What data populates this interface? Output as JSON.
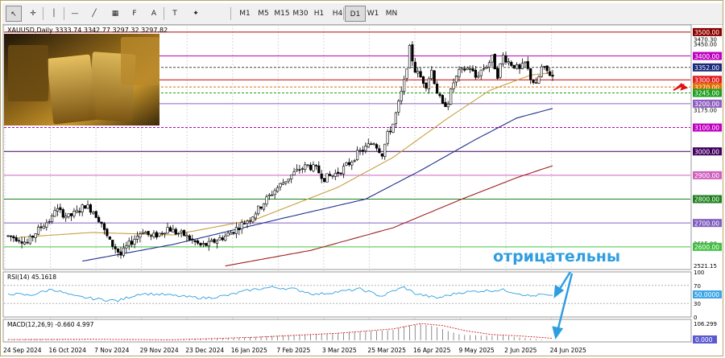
{
  "toolbar": {
    "tools": [
      {
        "name": "cursor-tool",
        "glyph": "↖",
        "active": true
      },
      {
        "name": "crosshair-tool",
        "glyph": "✛",
        "active": false
      },
      {
        "name": "vertical-line-tool",
        "glyph": "│",
        "active": false
      },
      {
        "name": "horizontal-line-tool",
        "glyph": "—",
        "active": false
      },
      {
        "name": "trendline-tool",
        "glyph": "╱",
        "active": false
      },
      {
        "name": "channel-tool",
        "glyph": "▦",
        "active": false
      },
      {
        "name": "fibonacci-tool",
        "glyph": "F",
        "active": false
      },
      {
        "name": "text-tool",
        "glyph": "A",
        "active": false
      },
      {
        "name": "label-tool",
        "glyph": "T",
        "active": false
      },
      {
        "name": "shapes-tool",
        "glyph": "✦",
        "active": false
      }
    ],
    "timeframes": [
      {
        "label": "M1",
        "active": false
      },
      {
        "label": "M5",
        "active": false
      },
      {
        "label": "M15",
        "active": false
      },
      {
        "label": "M30",
        "active": false
      },
      {
        "label": "H1",
        "active": false
      },
      {
        "label": "H4",
        "active": false
      },
      {
        "label": "D1",
        "active": true
      },
      {
        "label": "W1",
        "active": false
      },
      {
        "label": "MN",
        "active": false
      }
    ]
  },
  "chart_data": {
    "type": "candlestick",
    "symbol_header": "XAUUSD,Daily  3333.74  3342.77  3297.32  3297.82",
    "ylim": [
      2505,
      3530
    ],
    "price_ticks": [
      3470.3,
      3450.0,
      3352.0,
      3270.0,
      3245.0,
      3175.0,
      2615.0,
      2521.15
    ],
    "levels": [
      {
        "price": 3500,
        "label": "3500.00",
        "color": "#b00000",
        "style": "solid",
        "box": "#8b0000"
      },
      {
        "price": 3400,
        "label": "3400.00",
        "color": "#c000c0",
        "style": "solid",
        "box": "#c000c0"
      },
      {
        "price": 3352,
        "label": "3352.00",
        "color": "#444444",
        "style": "dashed",
        "box": "#1b2a7a"
      },
      {
        "price": 3300,
        "label": "3300.00",
        "color": "#d00000",
        "style": "solid",
        "box": "#e02020"
      },
      {
        "price": 3270,
        "label": "3270.00",
        "color": "#e07000",
        "style": "dashed",
        "box": "#e07000"
      },
      {
        "price": 3245,
        "label": "3245.00",
        "color": "#20a020",
        "style": "dashed",
        "box": "#20a020"
      },
      {
        "price": 3200,
        "label": "3200.00",
        "color": "#9060c0",
        "style": "solid",
        "box": "#9060c0"
      },
      {
        "price": 3100,
        "label": "3100.00",
        "color": "#c000c0",
        "style": "dashed",
        "box": "#c000c0"
      },
      {
        "price": 3000,
        "label": "3000.00",
        "color": "#400060",
        "style": "solid",
        "box": "#400060"
      },
      {
        "price": 2900,
        "label": "2900.00",
        "color": "#d060c0",
        "style": "solid",
        "box": "#d060c0"
      },
      {
        "price": 2800,
        "label": "2800.00",
        "color": "#208020",
        "style": "solid",
        "box": "#208020"
      },
      {
        "price": 2700,
        "label": "2700.00",
        "color": "#8060c0",
        "style": "solid",
        "box": "#8060c0"
      },
      {
        "price": 2600,
        "label": "2600.00",
        "color": "#40c040",
        "style": "solid",
        "box": "#40c040"
      }
    ],
    "dates": [
      "24 Sep 2024",
      "16 Oct 2024",
      "7 Nov 2024",
      "29 Nov 2024",
      "23 Dec 2024",
      "16 Jan 2025",
      "7 Feb 2025",
      "3 Mar 2025",
      "25 Mar 2025",
      "16 Apr 2025",
      "9 May 2025",
      "2 Jun 2025",
      "24 Jun 2025"
    ],
    "anchors": [
      [
        0,
        2645
      ],
      [
        4,
        2635
      ],
      [
        7,
        2615
      ],
      [
        10,
        2660
      ],
      [
        13,
        2695
      ],
      [
        16,
        2720
      ],
      [
        17,
        2760
      ],
      [
        19,
        2745
      ],
      [
        22,
        2725
      ],
      [
        25,
        2745
      ],
      [
        28,
        2775
      ],
      [
        31,
        2750
      ],
      [
        34,
        2700
      ],
      [
        35,
        2665
      ],
      [
        37,
        2620
      ],
      [
        39,
        2595
      ],
      [
        41,
        2565
      ],
      [
        43,
        2598
      ],
      [
        46,
        2635
      ],
      [
        49,
        2670
      ],
      [
        52,
        2640
      ],
      [
        55,
        2655
      ],
      [
        58,
        2680
      ],
      [
        61,
        2660
      ],
      [
        64,
        2650
      ],
      [
        67,
        2625
      ],
      [
        70,
        2605
      ],
      [
        73,
        2610
      ],
      [
        76,
        2630
      ],
      [
        79,
        2645
      ],
      [
        82,
        2668
      ],
      [
        85,
        2695
      ],
      [
        88,
        2720
      ],
      [
        91,
        2758
      ],
      [
        94,
        2800
      ],
      [
        97,
        2838
      ],
      [
        100,
        2870
      ],
      [
        103,
        2900
      ],
      [
        106,
        2925
      ],
      [
        109,
        2940
      ],
      [
        112,
        2925
      ],
      [
        115,
        2888
      ],
      [
        118,
        2900
      ],
      [
        121,
        2920
      ],
      [
        124,
        2950
      ],
      [
        127,
        2990
      ],
      [
        130,
        3015
      ],
      [
        133,
        3040
      ],
      [
        136,
        2990
      ],
      [
        138,
        3070
      ],
      [
        140,
        3115
      ],
      [
        142,
        3200
      ],
      [
        144,
        3290
      ],
      [
        146,
        3430
      ],
      [
        148,
        3340
      ],
      [
        150,
        3310
      ],
      [
        152,
        3280
      ],
      [
        154,
        3340
      ],
      [
        156,
        3250
      ],
      [
        158,
        3190
      ],
      [
        160,
        3210
      ],
      [
        162,
        3290
      ],
      [
        164,
        3330
      ],
      [
        166,
        3345
      ],
      [
        168,
        3350
      ],
      [
        170,
        3310
      ],
      [
        172,
        3340
      ],
      [
        174,
        3360
      ],
      [
        176,
        3390
      ],
      [
        178,
        3320
      ],
      [
        180,
        3400
      ],
      [
        182,
        3375
      ],
      [
        184,
        3360
      ],
      [
        186,
        3340
      ],
      [
        188,
        3370
      ],
      [
        190,
        3310
      ],
      [
        192,
        3275
      ],
      [
        194,
        3350
      ],
      [
        196,
        3335
      ],
      [
        198,
        3315
      ]
    ],
    "candle_count": 199,
    "moving_averages": [
      {
        "name": "ma-50",
        "color": "#c8a040",
        "start_index": 4,
        "points": [
          [
            4,
            2640
          ],
          [
            30,
            2660
          ],
          [
            60,
            2650
          ],
          [
            90,
            2715
          ],
          [
            120,
            2850
          ],
          [
            140,
            2975
          ],
          [
            160,
            3140
          ],
          [
            175,
            3255
          ],
          [
            190,
            3320
          ],
          [
            198,
            3330
          ]
        ]
      },
      {
        "name": "ma-100",
        "color": "#1f2f8a",
        "start_index": 27,
        "points": [
          [
            27,
            2540
          ],
          [
            60,
            2610
          ],
          [
            100,
            2720
          ],
          [
            130,
            2800
          ],
          [
            150,
            2920
          ],
          [
            170,
            3050
          ],
          [
            185,
            3140
          ],
          [
            198,
            3180
          ]
        ]
      },
      {
        "name": "ma-200",
        "color": "#a02020",
        "start_index": 79,
        "points": [
          [
            79,
            2520
          ],
          [
            110,
            2585
          ],
          [
            140,
            2680
          ],
          [
            165,
            2800
          ],
          [
            185,
            2890
          ],
          [
            198,
            2940
          ]
        ]
      }
    ],
    "annotation": "отрицательны",
    "rsi": {
      "label": "RSI(14) 45.1618",
      "ylim": [
        0,
        100
      ],
      "ticks": [
        {
          "v": 100,
          "label": "100"
        },
        {
          "v": 70,
          "label": "70"
        },
        {
          "v": 30,
          "label": "30"
        },
        {
          "v": 0,
          "label": "0"
        }
      ],
      "current_label": "50.0000",
      "points": [
        [
          0,
          52
        ],
        [
          8,
          48
        ],
        [
          16,
          62
        ],
        [
          24,
          46
        ],
        [
          32,
          40
        ],
        [
          40,
          36
        ],
        [
          48,
          52
        ],
        [
          56,
          50
        ],
        [
          64,
          45
        ],
        [
          72,
          42
        ],
        [
          80,
          48
        ],
        [
          88,
          60
        ],
        [
          96,
          66
        ],
        [
          104,
          62
        ],
        [
          112,
          50
        ],
        [
          120,
          56
        ],
        [
          128,
          62
        ],
        [
          136,
          46
        ],
        [
          140,
          58
        ],
        [
          144,
          66
        ],
        [
          148,
          52
        ],
        [
          156,
          42
        ],
        [
          164,
          54
        ],
        [
          172,
          58
        ],
        [
          180,
          60
        ],
        [
          186,
          52
        ],
        [
          190,
          46
        ],
        [
          194,
          50
        ],
        [
          198,
          45
        ]
      ]
    },
    "macd": {
      "label": "MACD(12,26,9) -0.660 4.997",
      "ylim": [
        -5,
        115
      ],
      "ticks": [
        {
          "v": 106.299,
          "label": "106.299"
        },
        {
          "v": 0,
          "label": "0.000"
        }
      ],
      "histogram": [
        [
          0,
          3
        ],
        [
          20,
          8
        ],
        [
          40,
          -2
        ],
        [
          60,
          4
        ],
        [
          80,
          12
        ],
        [
          100,
          30
        ],
        [
          120,
          45
        ],
        [
          140,
          62
        ],
        [
          145,
          88
        ],
        [
          150,
          96
        ],
        [
          155,
          84
        ],
        [
          160,
          55
        ],
        [
          165,
          32
        ],
        [
          170,
          30
        ],
        [
          175,
          26
        ],
        [
          180,
          28
        ],
        [
          185,
          18
        ],
        [
          190,
          10
        ],
        [
          198,
          -1
        ]
      ],
      "signal": [
        [
          0,
          4
        ],
        [
          30,
          6
        ],
        [
          60,
          3
        ],
        [
          90,
          18
        ],
        [
          120,
          42
        ],
        [
          140,
          68
        ],
        [
          150,
          100
        ],
        [
          158,
          88
        ],
        [
          166,
          58
        ],
        [
          176,
          34
        ],
        [
          186,
          26
        ],
        [
          198,
          12
        ]
      ]
    }
  }
}
